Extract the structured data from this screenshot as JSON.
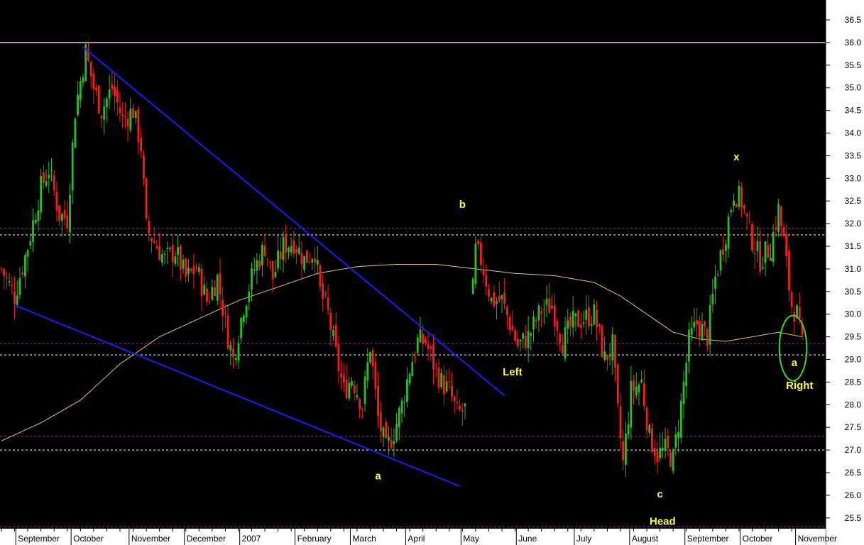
{
  "colors": {
    "background": "#000000",
    "axis_panel": "#ffffff",
    "bull_candle": "#22c222",
    "bear_candle": "#ff1a1a",
    "trendline": "#1a1aff",
    "moving_average": "#e8c860",
    "annotation_text": "#ffff33",
    "circle": "#33dd22",
    "resistance_line": "#e8c0ff"
  },
  "chart_data": {
    "type": "candlestick",
    "title": "",
    "xlabel": "",
    "ylabel": "",
    "ylim": [
      25.2,
      36.8
    ],
    "y_ticks": [
      "25.5",
      "26.0",
      "26.5",
      "27.0",
      "27.5",
      "28.0",
      "28.5",
      "29.0",
      "29.5",
      "30.0",
      "30.5",
      "31.0",
      "31.5",
      "32.0",
      "32.5",
      "33.0",
      "33.5",
      "34.0",
      "34.5",
      "35.0",
      "35.5",
      "36.0",
      "36.5"
    ],
    "x_range": [
      0,
      300
    ],
    "month_labels": [
      {
        "text": "September",
        "x": 9
      },
      {
        "text": "October",
        "x": 30
      },
      {
        "text": "November",
        "x": 52
      },
      {
        "text": "December",
        "x": 74
      },
      {
        "text": "2007",
        "x": 94
      },
      {
        "text": "February",
        "x": 116
      },
      {
        "text": "March",
        "x": 135
      },
      {
        "text": "April",
        "x": 157
      },
      {
        "text": "May",
        "x": 178
      },
      {
        "text": "June",
        "x": 200
      },
      {
        "text": "July",
        "x": 221
      },
      {
        "text": "August",
        "x": 243
      },
      {
        "text": "September",
        "x": 264
      },
      {
        "text": "October",
        "x": 284
      },
      {
        "text": "November",
        "x": 306
      }
    ],
    "month_separators": [
      6,
      27,
      49,
      70,
      91,
      112,
      133,
      154,
      175,
      196,
      218,
      239,
      260,
      281,
      302
    ],
    "price_anchors": [
      [
        0,
        31.0
      ],
      [
        5,
        30.4
      ],
      [
        10,
        31.5
      ],
      [
        15,
        32.8
      ],
      [
        18,
        33.2
      ],
      [
        22,
        32.2
      ],
      [
        25,
        32.1
      ],
      [
        28,
        34.5
      ],
      [
        32,
        35.8
      ],
      [
        35,
        35.0
      ],
      [
        38,
        34.5
      ],
      [
        42,
        35.0
      ],
      [
        46,
        34.3
      ],
      [
        50,
        34.5
      ],
      [
        53,
        33.7
      ],
      [
        55,
        31.9
      ],
      [
        58,
        31.6
      ],
      [
        62,
        31.2
      ],
      [
        66,
        31.4
      ],
      [
        70,
        30.8
      ],
      [
        74,
        31.0
      ],
      [
        78,
        30.3
      ],
      [
        82,
        30.8
      ],
      [
        86,
        29.5
      ],
      [
        88,
        29.0
      ],
      [
        92,
        30.2
      ],
      [
        96,
        31.0
      ],
      [
        100,
        31.5
      ],
      [
        103,
        30.8
      ],
      [
        107,
        31.5
      ],
      [
        111,
        31.6
      ],
      [
        115,
        31.2
      ],
      [
        119,
        31.4
      ],
      [
        121,
        30.5
      ],
      [
        124,
        30.0
      ],
      [
        127,
        29.1
      ],
      [
        130,
        28.3
      ],
      [
        133,
        28.6
      ],
      [
        137,
        28.0
      ],
      [
        140,
        29.3
      ],
      [
        143,
        27.7
      ],
      [
        146,
        27.0
      ],
      [
        149,
        27.4
      ],
      [
        152,
        28.0
      ],
      [
        155,
        28.8
      ],
      [
        158,
        29.4
      ],
      [
        161,
        29.4
      ],
      [
        164,
        28.9
      ],
      [
        167,
        28.5
      ],
      [
        170,
        28.3
      ],
      [
        173,
        27.8
      ],
      [
        176,
        27.9
      ],
      [
        180,
        31.4
      ],
      [
        182,
        31.2
      ],
      [
        186,
        30.3
      ],
      [
        190,
        30.3
      ],
      [
        193,
        29.8
      ],
      [
        196,
        29.3
      ],
      [
        200,
        29.5
      ],
      [
        205,
        30.1
      ],
      [
        209,
        30.2
      ],
      [
        213,
        29.4
      ],
      [
        217,
        29.8
      ],
      [
        221,
        29.9
      ],
      [
        225,
        30.0
      ],
      [
        229,
        29.0
      ],
      [
        232,
        29.3
      ],
      [
        234,
        27.8
      ],
      [
        236,
        26.7
      ],
      [
        239,
        28.3
      ],
      [
        243,
        28.5
      ],
      [
        246,
        27.3
      ],
      [
        249,
        26.9
      ],
      [
        252,
        27.0
      ],
      [
        255,
        26.8
      ],
      [
        258,
        28.0
      ],
      [
        261,
        29.4
      ],
      [
        264,
        29.8
      ],
      [
        268,
        29.5
      ],
      [
        271,
        30.8
      ],
      [
        275,
        31.8
      ],
      [
        278,
        32.7
      ],
      [
        281,
        32.5
      ],
      [
        284,
        31.8
      ],
      [
        288,
        31.2
      ],
      [
        292,
        31.5
      ],
      [
        295,
        32.3
      ],
      [
        297,
        31.6
      ],
      [
        299,
        30.6
      ],
      [
        300,
        30.2
      ],
      [
        302,
        30.0
      ],
      [
        304,
        29.3
      ]
    ],
    "moving_average": [
      [
        0,
        27.2
      ],
      [
        15,
        27.6
      ],
      [
        30,
        28.1
      ],
      [
        45,
        28.9
      ],
      [
        60,
        29.5
      ],
      [
        75,
        29.9
      ],
      [
        90,
        30.3
      ],
      [
        105,
        30.6
      ],
      [
        120,
        30.9
      ],
      [
        135,
        31.05
      ],
      [
        150,
        31.1
      ],
      [
        165,
        31.1
      ],
      [
        180,
        31.0
      ],
      [
        195,
        30.9
      ],
      [
        210,
        30.85
      ],
      [
        225,
        30.7
      ],
      [
        235,
        30.4
      ],
      [
        245,
        30.0
      ],
      [
        255,
        29.6
      ],
      [
        265,
        29.45
      ],
      [
        275,
        29.4
      ],
      [
        285,
        29.5
      ],
      [
        295,
        29.6
      ],
      [
        304,
        29.5
      ]
    ],
    "trendlines": [
      {
        "from": [
          31,
          35.9
        ],
        "to": [
          191,
          28.2
        ]
      },
      {
        "from": [
          5,
          30.2
        ],
        "to": [
          174,
          26.2
        ]
      }
    ],
    "horizontal_lines": [
      {
        "y": 36.0,
        "style": "solid",
        "color": "#e8c0ff"
      },
      {
        "y": 31.75,
        "style": "dashed",
        "color": "#ffffff"
      },
      {
        "y": 29.1,
        "style": "dashed",
        "color": "#ffffff"
      },
      {
        "y": 27.0,
        "style": "dashed",
        "color": "#ffffff"
      },
      {
        "y": 31.9,
        "style": "dashed",
        "color": "#8a3a8a"
      },
      {
        "y": 29.35,
        "style": "dashed",
        "color": "#8a3a8a"
      },
      {
        "y": 27.3,
        "style": "dashed",
        "color": "#8a3a8a"
      },
      {
        "y": 25.3,
        "style": "dashed",
        "color": "#8a3a8a"
      }
    ],
    "annotations": [
      {
        "text": "a",
        "x": 143,
        "y": 26.35
      },
      {
        "text": "b",
        "x": 175,
        "y": 32.35
      },
      {
        "text": "Left",
        "x": 194,
        "y": 28.65
      },
      {
        "text": "x",
        "x": 279,
        "y": 33.4
      },
      {
        "text": "c",
        "x": 250,
        "y": 25.95
      },
      {
        "text": "Head",
        "x": 251,
        "y": 25.35
      },
      {
        "text": "a",
        "x": 301,
        "y": 28.85
      },
      {
        "text": "Right",
        "x": 303,
        "y": 28.35
      }
    ],
    "highlight_circle": {
      "cx": 300.5,
      "cy": 29.25,
      "r_x": 5.2,
      "r_y": 0.72
    }
  }
}
